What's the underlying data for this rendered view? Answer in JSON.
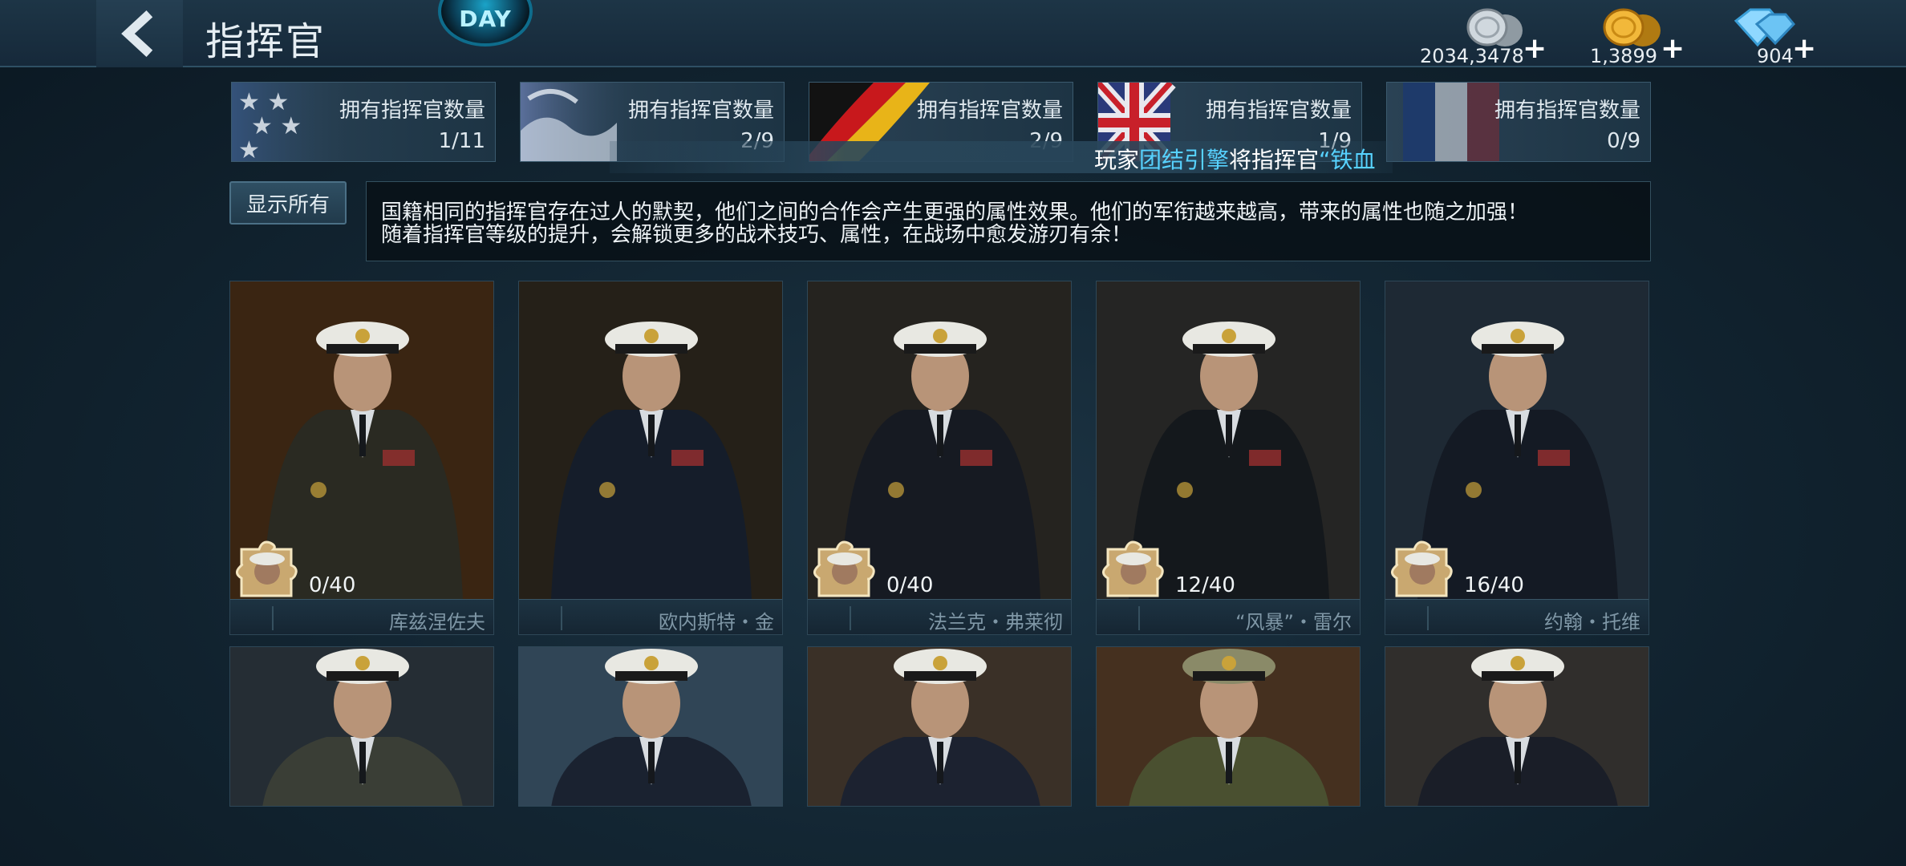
{
  "header": {
    "title": "指挥官",
    "event_badge": "DAY"
  },
  "currencies": [
    {
      "icon": "silver-coins-icon",
      "value": "2034,3478"
    },
    {
      "icon": "gold-coins-icon",
      "value": "1,3899"
    },
    {
      "icon": "diamond-icon",
      "value": "904"
    }
  ],
  "nations": [
    {
      "flag": "usa-flag",
      "label": "拥有指挥官数量",
      "count": "1/11"
    },
    {
      "flag": "japan-flag",
      "label": "拥有指挥官数量",
      "count": "2/9"
    },
    {
      "flag": "germany-flag",
      "label": "拥有指挥官数量",
      "count": "2/9"
    },
    {
      "flag": "uk-flag",
      "label": "拥有指挥官数量",
      "count": "1/9"
    },
    {
      "flag": "france-flag",
      "label": "拥有指挥官数量",
      "count": "0/9"
    }
  ],
  "ticker": {
    "prefix": "玩家",
    "player": "团结引擎",
    "middle": "将指挥官",
    "quote": "“铁血"
  },
  "filter": {
    "show_all": "显示所有"
  },
  "description": {
    "line1": "国籍相同的指挥官存在过人的默契，他们之间的合作会产生更强的属性效果。他们的军衔越来越高，带来的属性也随之加强！",
    "line2": "随着指挥官等级的提升，会解锁更多的战术技巧、属性，在战场中愈发游刃有余！"
  },
  "commanders": [
    {
      "name": "库兹涅佐夫",
      "fragments": "0/40",
      "uniform": "#2a2a22",
      "bg": "#5a3a1c"
    },
    {
      "name": "欧内斯特・金",
      "fragments": "",
      "uniform": "#151d2a",
      "bg": "#3a3226"
    },
    {
      "name": "法兰克・弗莱彻",
      "fragments": "0/40",
      "uniform": "#161a22",
      "bg": "#3a3630"
    },
    {
      "name": "“风暴”・雷尔",
      "fragments": "12/40",
      "uniform": "#14181c",
      "bg": "#3a3a38"
    },
    {
      "name": "约翰・托维",
      "fragments": "16/40",
      "uniform": "#141a24",
      "bg": "#2e4050"
    }
  ],
  "commanders_row2": [
    {
      "uniform": "#3a3e36",
      "bg": "#3a4650"
    },
    {
      "uniform": "#1a2230",
      "bg": "#4a6a84"
    },
    {
      "uniform": "#1c2230",
      "bg": "#5a4a3c"
    },
    {
      "uniform": "#4a5030",
      "bg": "#6a4a30"
    },
    {
      "uniform": "#1a1e28",
      "bg": "#4a4844"
    }
  ]
}
